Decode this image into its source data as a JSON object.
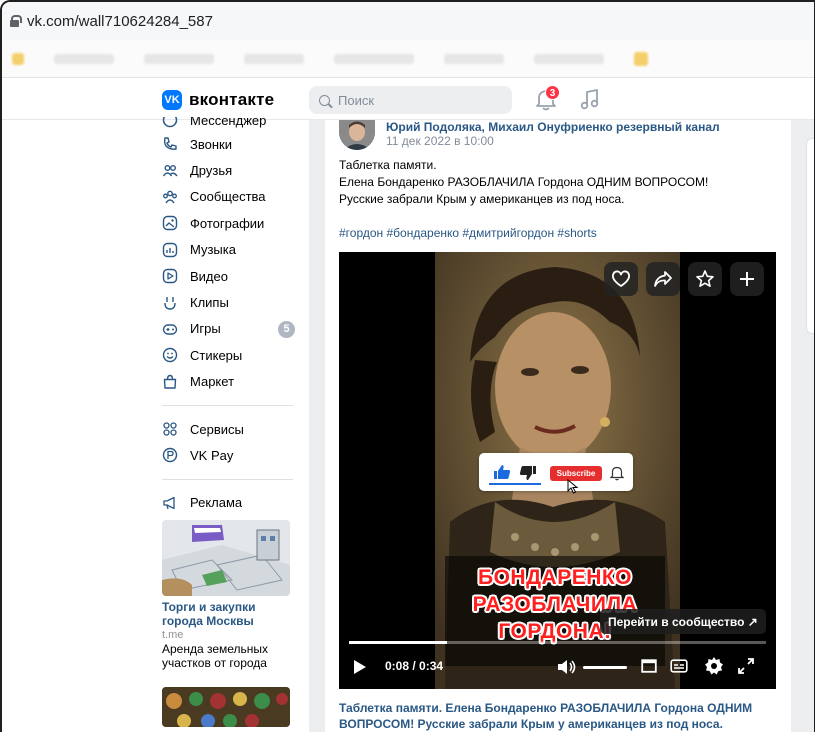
{
  "browser": {
    "url": "vk.com/wall710624284_587"
  },
  "header": {
    "logo_text": "вконтакте",
    "search_placeholder": "Поиск",
    "notifications_count": "3"
  },
  "sidebar": {
    "items": [
      {
        "label": "Мессенджер",
        "icon": "chat-icon"
      },
      {
        "label": "Звонки",
        "icon": "phone-icon"
      },
      {
        "label": "Друзья",
        "icon": "friends-icon"
      },
      {
        "label": "Сообщества",
        "icon": "communities-icon"
      },
      {
        "label": "Фотографии",
        "icon": "photo-icon"
      },
      {
        "label": "Музыка",
        "icon": "music-icon"
      },
      {
        "label": "Видео",
        "icon": "video-icon"
      },
      {
        "label": "Клипы",
        "icon": "clips-icon"
      },
      {
        "label": "Игры",
        "icon": "games-icon",
        "badge": "5"
      },
      {
        "label": "Стикеры",
        "icon": "stickers-icon"
      },
      {
        "label": "Маркет",
        "icon": "market-icon"
      }
    ],
    "secondary": [
      {
        "label": "Сервисы",
        "icon": "services-icon"
      },
      {
        "label": "VK Pay",
        "icon": "vkpay-icon"
      }
    ],
    "ads_label": "Реклама",
    "ad": {
      "title": "Торги и закупки города Москвы",
      "source": "t.me",
      "description": "Аренда земельных участков от города"
    }
  },
  "post": {
    "author": "Юрий Подоляка, Михаил Онуфриенко резервный канал",
    "date": "11 дек 2022 в 10:00",
    "lines": [
      "Таблетка памяти.",
      "Елена Бондаренко РАЗОБЛАЧИЛА Гордона ОДНИМ ВОПРОСОМ!",
      "Русские забрали Крым у американцев из под носа."
    ],
    "hashtags": "#гордон #бондаренко #дмитрийгордон #shorts",
    "video": {
      "overlay_lines": [
        "БОНДАРЕНКО",
        "РАЗОБЛАЧИЛА",
        "ГОРДОНА!"
      ],
      "subscribe_label": "Subscribe",
      "goto_label": "Перейти в сообщество ↗",
      "time": "0:08 / 0:34",
      "progress_fraction": 0.235
    },
    "caption_line1": "Таблетка памяти. Елена Бондаренко РАЗОБЛАЧИЛА Гордона ОДНИМ",
    "caption_line2": "ВОПРОСОМ! Русские забрали Крым у американцев из под носа."
  },
  "colors": {
    "vk_blue": "#0077ff",
    "link": "#2a5885",
    "badge_red": "#ff3347"
  }
}
